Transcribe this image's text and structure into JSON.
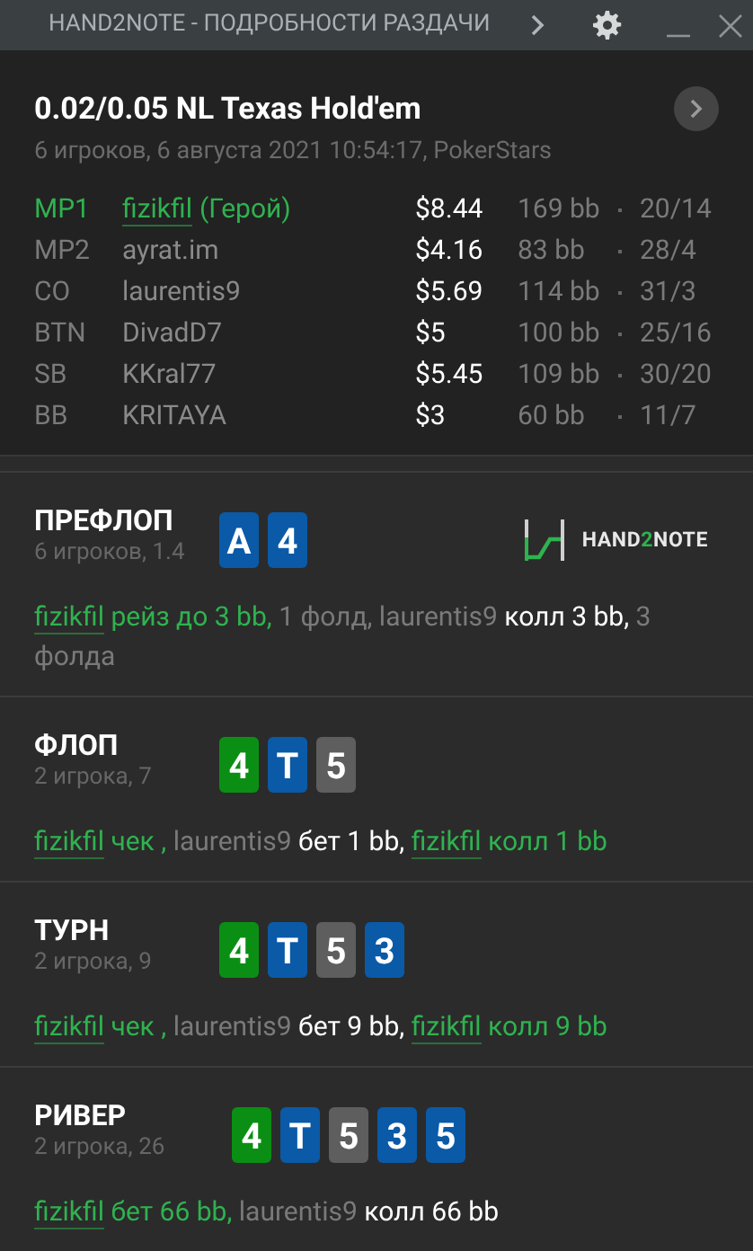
{
  "window": {
    "title": "HAND2NOTE - ПОДРОБНОСТИ РАЗДАЧИ"
  },
  "hand": {
    "title": "0.02/0.05 NL Texas Hold'em",
    "subtitle": "6 игроков, 6 августа 2021 10:54:17, PokerStars",
    "players": [
      {
        "position": "MP1",
        "name": "fizikfil",
        "hero": true,
        "hero_label": "(Герой)",
        "stack": "$8.44",
        "bb": "169 bb",
        "stats": "20/14"
      },
      {
        "position": "MP2",
        "name": "ayrat.im",
        "hero": false,
        "stack": "$4.16",
        "bb": "83 bb",
        "stats": "28/4"
      },
      {
        "position": "CO",
        "name": "laurentis9",
        "hero": false,
        "stack": "$5.69",
        "bb": "114 bb",
        "stats": "31/3"
      },
      {
        "position": "BTN",
        "name": "DivadD7",
        "hero": false,
        "stack": "$5",
        "bb": "100 bb",
        "stats": "25/16"
      },
      {
        "position": "SB",
        "name": "KKral77",
        "hero": false,
        "stack": "$5.45",
        "bb": "109 bb",
        "stats": "30/20"
      },
      {
        "position": "BB",
        "name": "KRITAYA",
        "hero": false,
        "stack": "$3",
        "bb": "60 bb",
        "stats": "11/7"
      }
    ]
  },
  "logo": {
    "text_before": "HAND",
    "accent": "2",
    "text_after": "NOTE"
  },
  "streets": [
    {
      "name": "ПРЕФЛОП",
      "info": "6 игроков, 1.4",
      "cards": [
        {
          "rank": "A",
          "color": "#0a5aa8"
        },
        {
          "rank": "4",
          "color": "#0a5aa8"
        }
      ],
      "actions": [
        {
          "kind": "hero",
          "text": "fizikfil"
        },
        {
          "kind": "hero_action",
          "text": " рейз до 3 bb,"
        },
        {
          "kind": "other",
          "text": " 1 фолд, laurentis9 "
        },
        {
          "kind": "action",
          "text": "колл 3 bb,"
        },
        {
          "kind": "other",
          "text": " 3 фолда"
        }
      ]
    },
    {
      "name": "ФЛОП",
      "info": "2 игрока, 7",
      "cards": [
        {
          "rank": "4",
          "color": "#0a8f14"
        },
        {
          "rank": "T",
          "color": "#0a5aa8"
        },
        {
          "rank": "5",
          "color": "#5e5e5e"
        }
      ],
      "actions": [
        {
          "kind": "hero",
          "text": "fizikfil"
        },
        {
          "kind": "hero_action",
          "text": " чек ,"
        },
        {
          "kind": "other",
          "text": " laurentis9 "
        },
        {
          "kind": "action",
          "text": "бет 1 bb, "
        },
        {
          "kind": "hero",
          "text": "fizikfil"
        },
        {
          "kind": "hero_action",
          "text": " колл 1 bb"
        }
      ]
    },
    {
      "name": "ТУРН",
      "info": "2 игрока, 9",
      "cards": [
        {
          "rank": "4",
          "color": "#0a8f14"
        },
        {
          "rank": "T",
          "color": "#0a5aa8"
        },
        {
          "rank": "5",
          "color": "#5e5e5e"
        },
        {
          "rank": "3",
          "color": "#0a5aa8"
        }
      ],
      "actions": [
        {
          "kind": "hero",
          "text": "fizikfil"
        },
        {
          "kind": "hero_action",
          "text": " чек ,"
        },
        {
          "kind": "other",
          "text": " laurentis9 "
        },
        {
          "kind": "action",
          "text": "бет 9 bb, "
        },
        {
          "kind": "hero",
          "text": "fizikfil"
        },
        {
          "kind": "hero_action",
          "text": " колл 9 bb"
        }
      ]
    },
    {
      "name": "РИВЕР",
      "info": "2 игрока, 26",
      "cards": [
        {
          "rank": "4",
          "color": "#0a8f14"
        },
        {
          "rank": "T",
          "color": "#0a5aa8"
        },
        {
          "rank": "5",
          "color": "#5e5e5e"
        },
        {
          "rank": "3",
          "color": "#0a5aa8"
        },
        {
          "rank": "5",
          "color": "#0a5aa8"
        }
      ],
      "actions": [
        {
          "kind": "hero",
          "text": "fizikfil"
        },
        {
          "kind": "hero_action",
          "text": " бет 66 bb,"
        },
        {
          "kind": "other",
          "text": " laurentis9 "
        },
        {
          "kind": "action",
          "text": "колл 66 bb"
        }
      ]
    }
  ]
}
